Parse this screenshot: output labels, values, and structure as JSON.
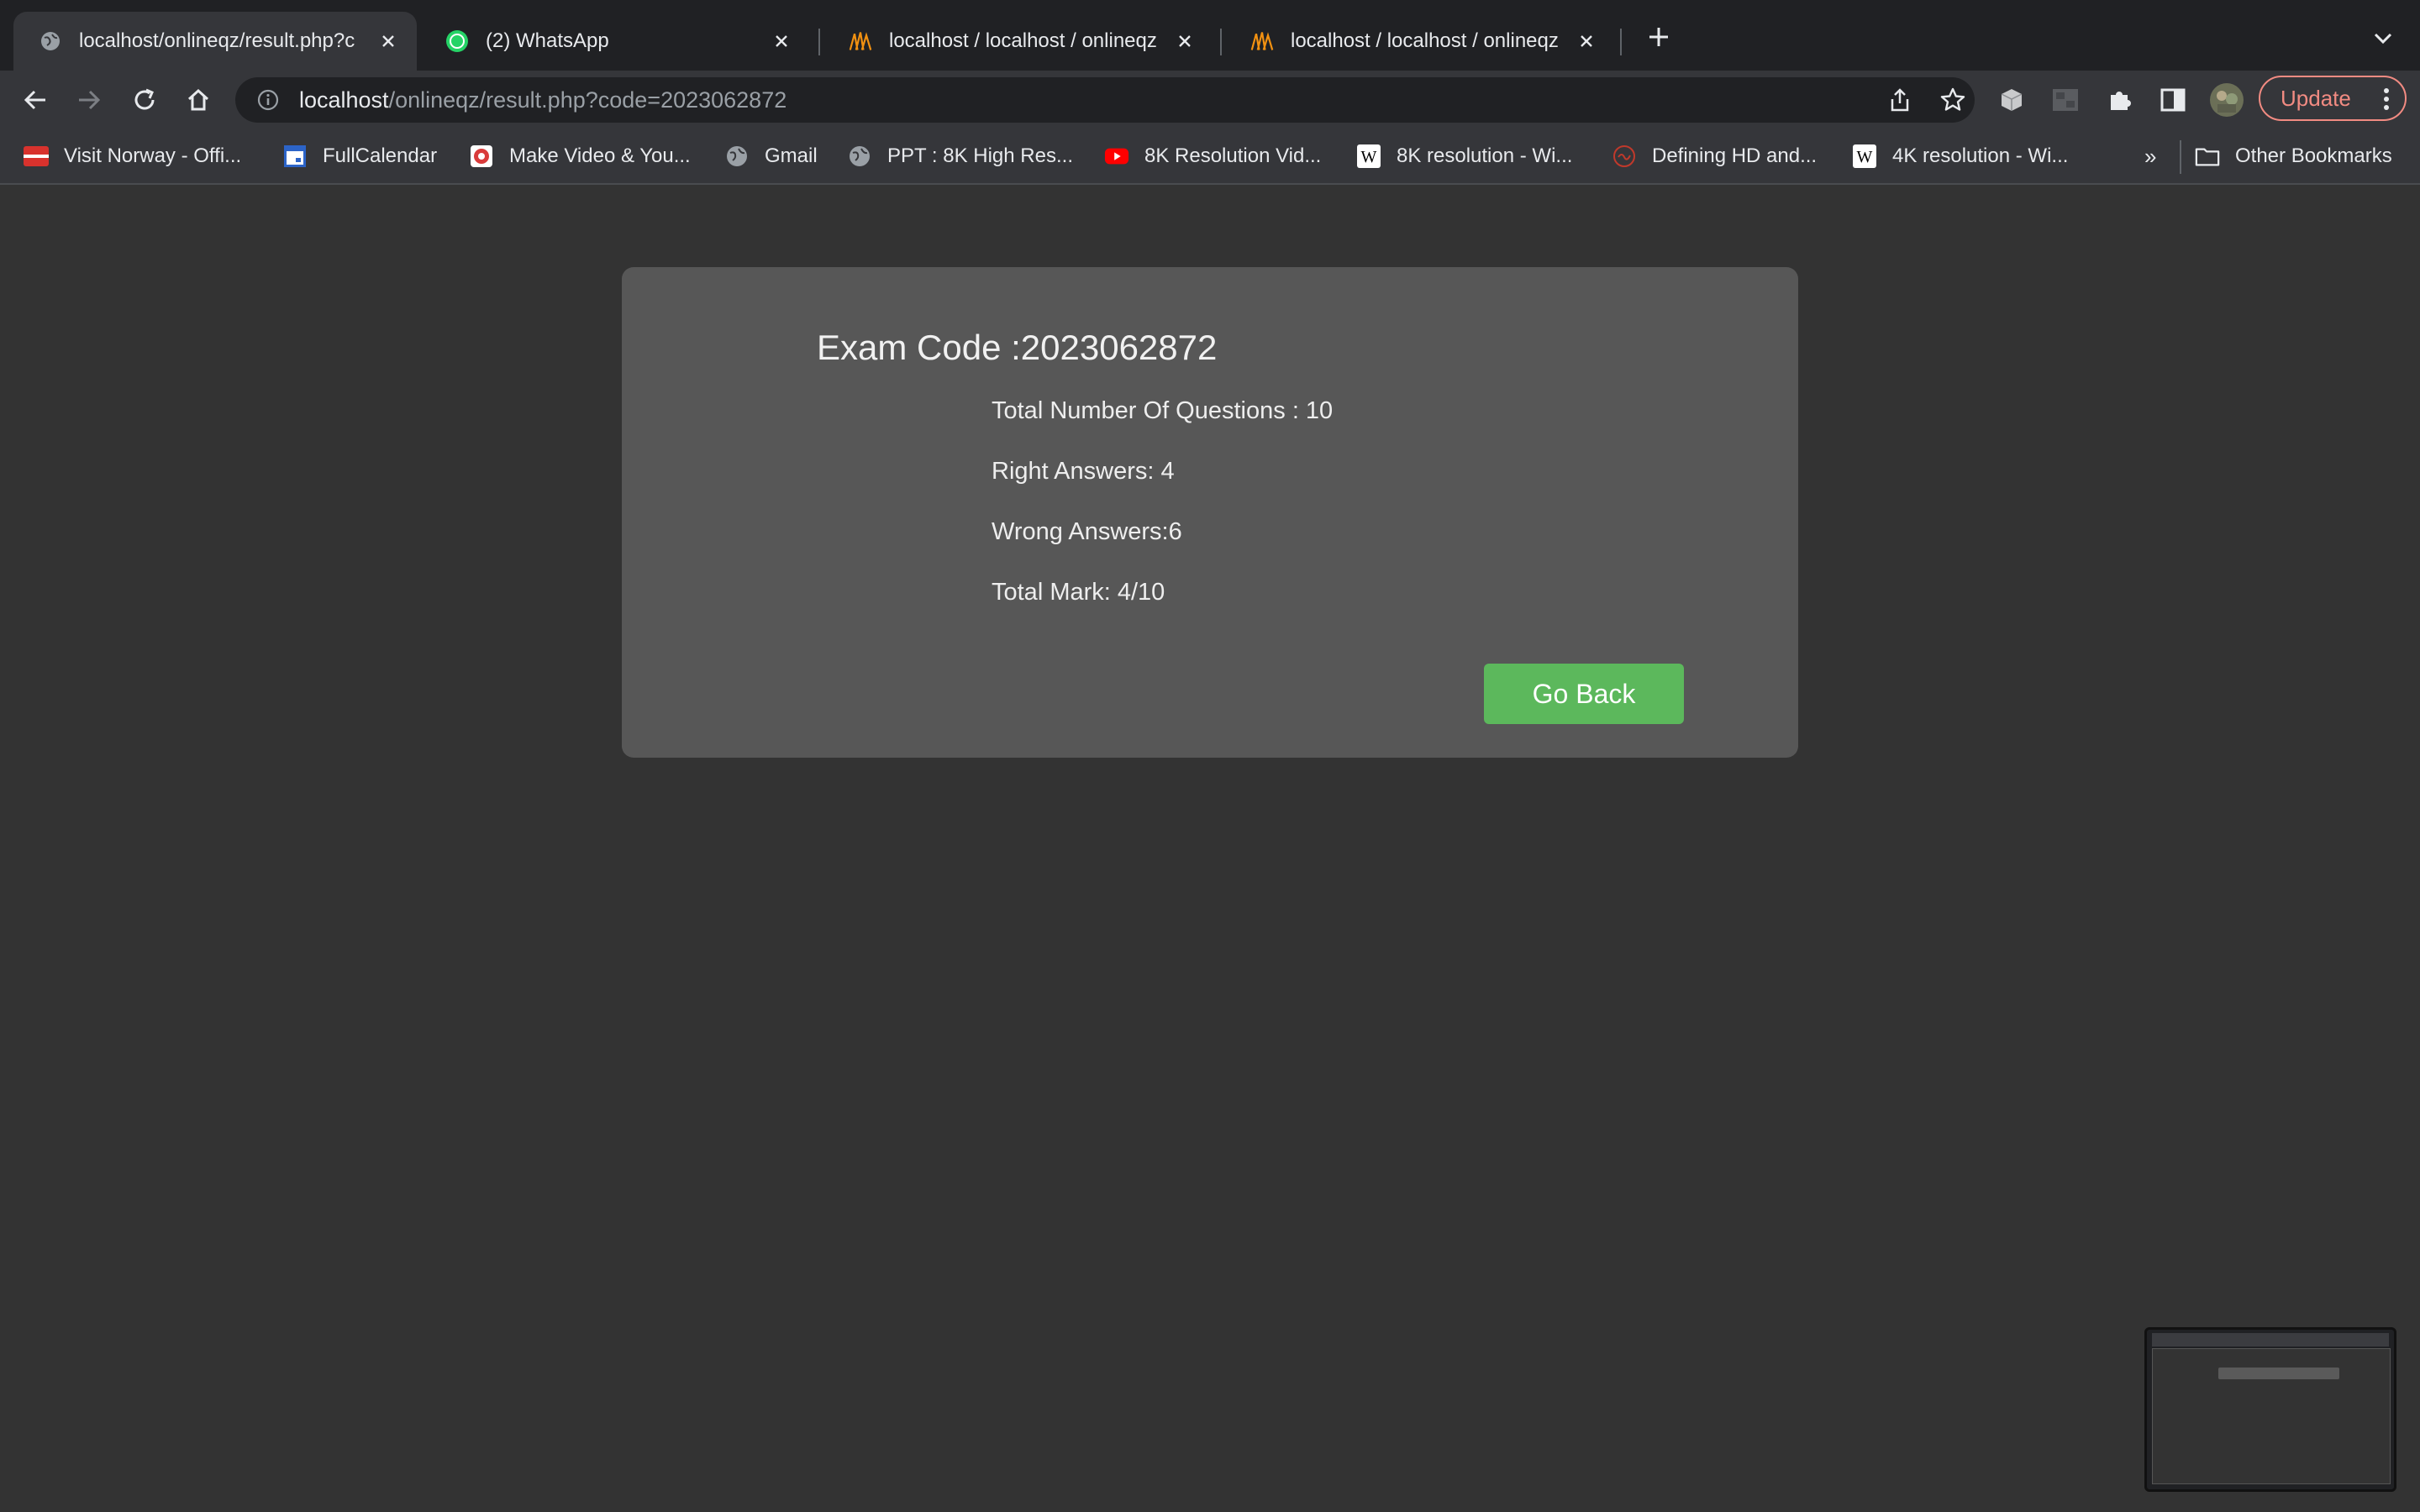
{
  "browser": {
    "tabs": [
      {
        "title": "localhost/onlineqz/result.php?c",
        "favicon": "globe-icon",
        "active": true
      },
      {
        "title": "(2) WhatsApp",
        "favicon": "whatsapp-icon",
        "badge": "2"
      },
      {
        "title": "localhost / localhost / onlineqz",
        "favicon": "phpmyadmin-icon"
      },
      {
        "title": "localhost / localhost / onlineqz",
        "favicon": "phpmyadmin-icon"
      }
    ],
    "url_host": "localhost",
    "url_path": "/onlineqz/result.php?code=2023062872",
    "update_label": "Update",
    "bookmarks": [
      {
        "label": "Visit Norway - Offi...",
        "icon": "norway-flag-icon"
      },
      {
        "label": "FullCalendar",
        "icon": "calendar-icon"
      },
      {
        "label": "Make Video & You...",
        "icon": "video-icon"
      },
      {
        "label": "Gmail",
        "icon": "globe-icon"
      },
      {
        "label": "PPT : 8K High Res...",
        "icon": "globe-icon"
      },
      {
        "label": "8K Resolution Vid...",
        "icon": "youtube-icon"
      },
      {
        "label": "8K resolution - Wi...",
        "icon": "wikipedia-icon"
      },
      {
        "label": "Defining HD and...",
        "icon": "hd-icon"
      },
      {
        "label": "4K resolution - Wi...",
        "icon": "wikipedia-icon"
      }
    ],
    "more_bookmarks": "»",
    "other_bookmarks": "Other Bookmarks"
  },
  "result": {
    "exam_code": "Exam Code :2023062872",
    "total_questions": "Total Number Of Questions : 10",
    "right_answers": "Right Answers: 4",
    "wrong_answers": "Wrong Answers:6",
    "total_mark": "Total Mark: 4/10",
    "go_back_label": "Go Back"
  },
  "colors": {
    "page_bg": "#333333",
    "card_bg": "#575757",
    "button_bg": "#5cb85c",
    "update_accent": "#f28b82"
  }
}
